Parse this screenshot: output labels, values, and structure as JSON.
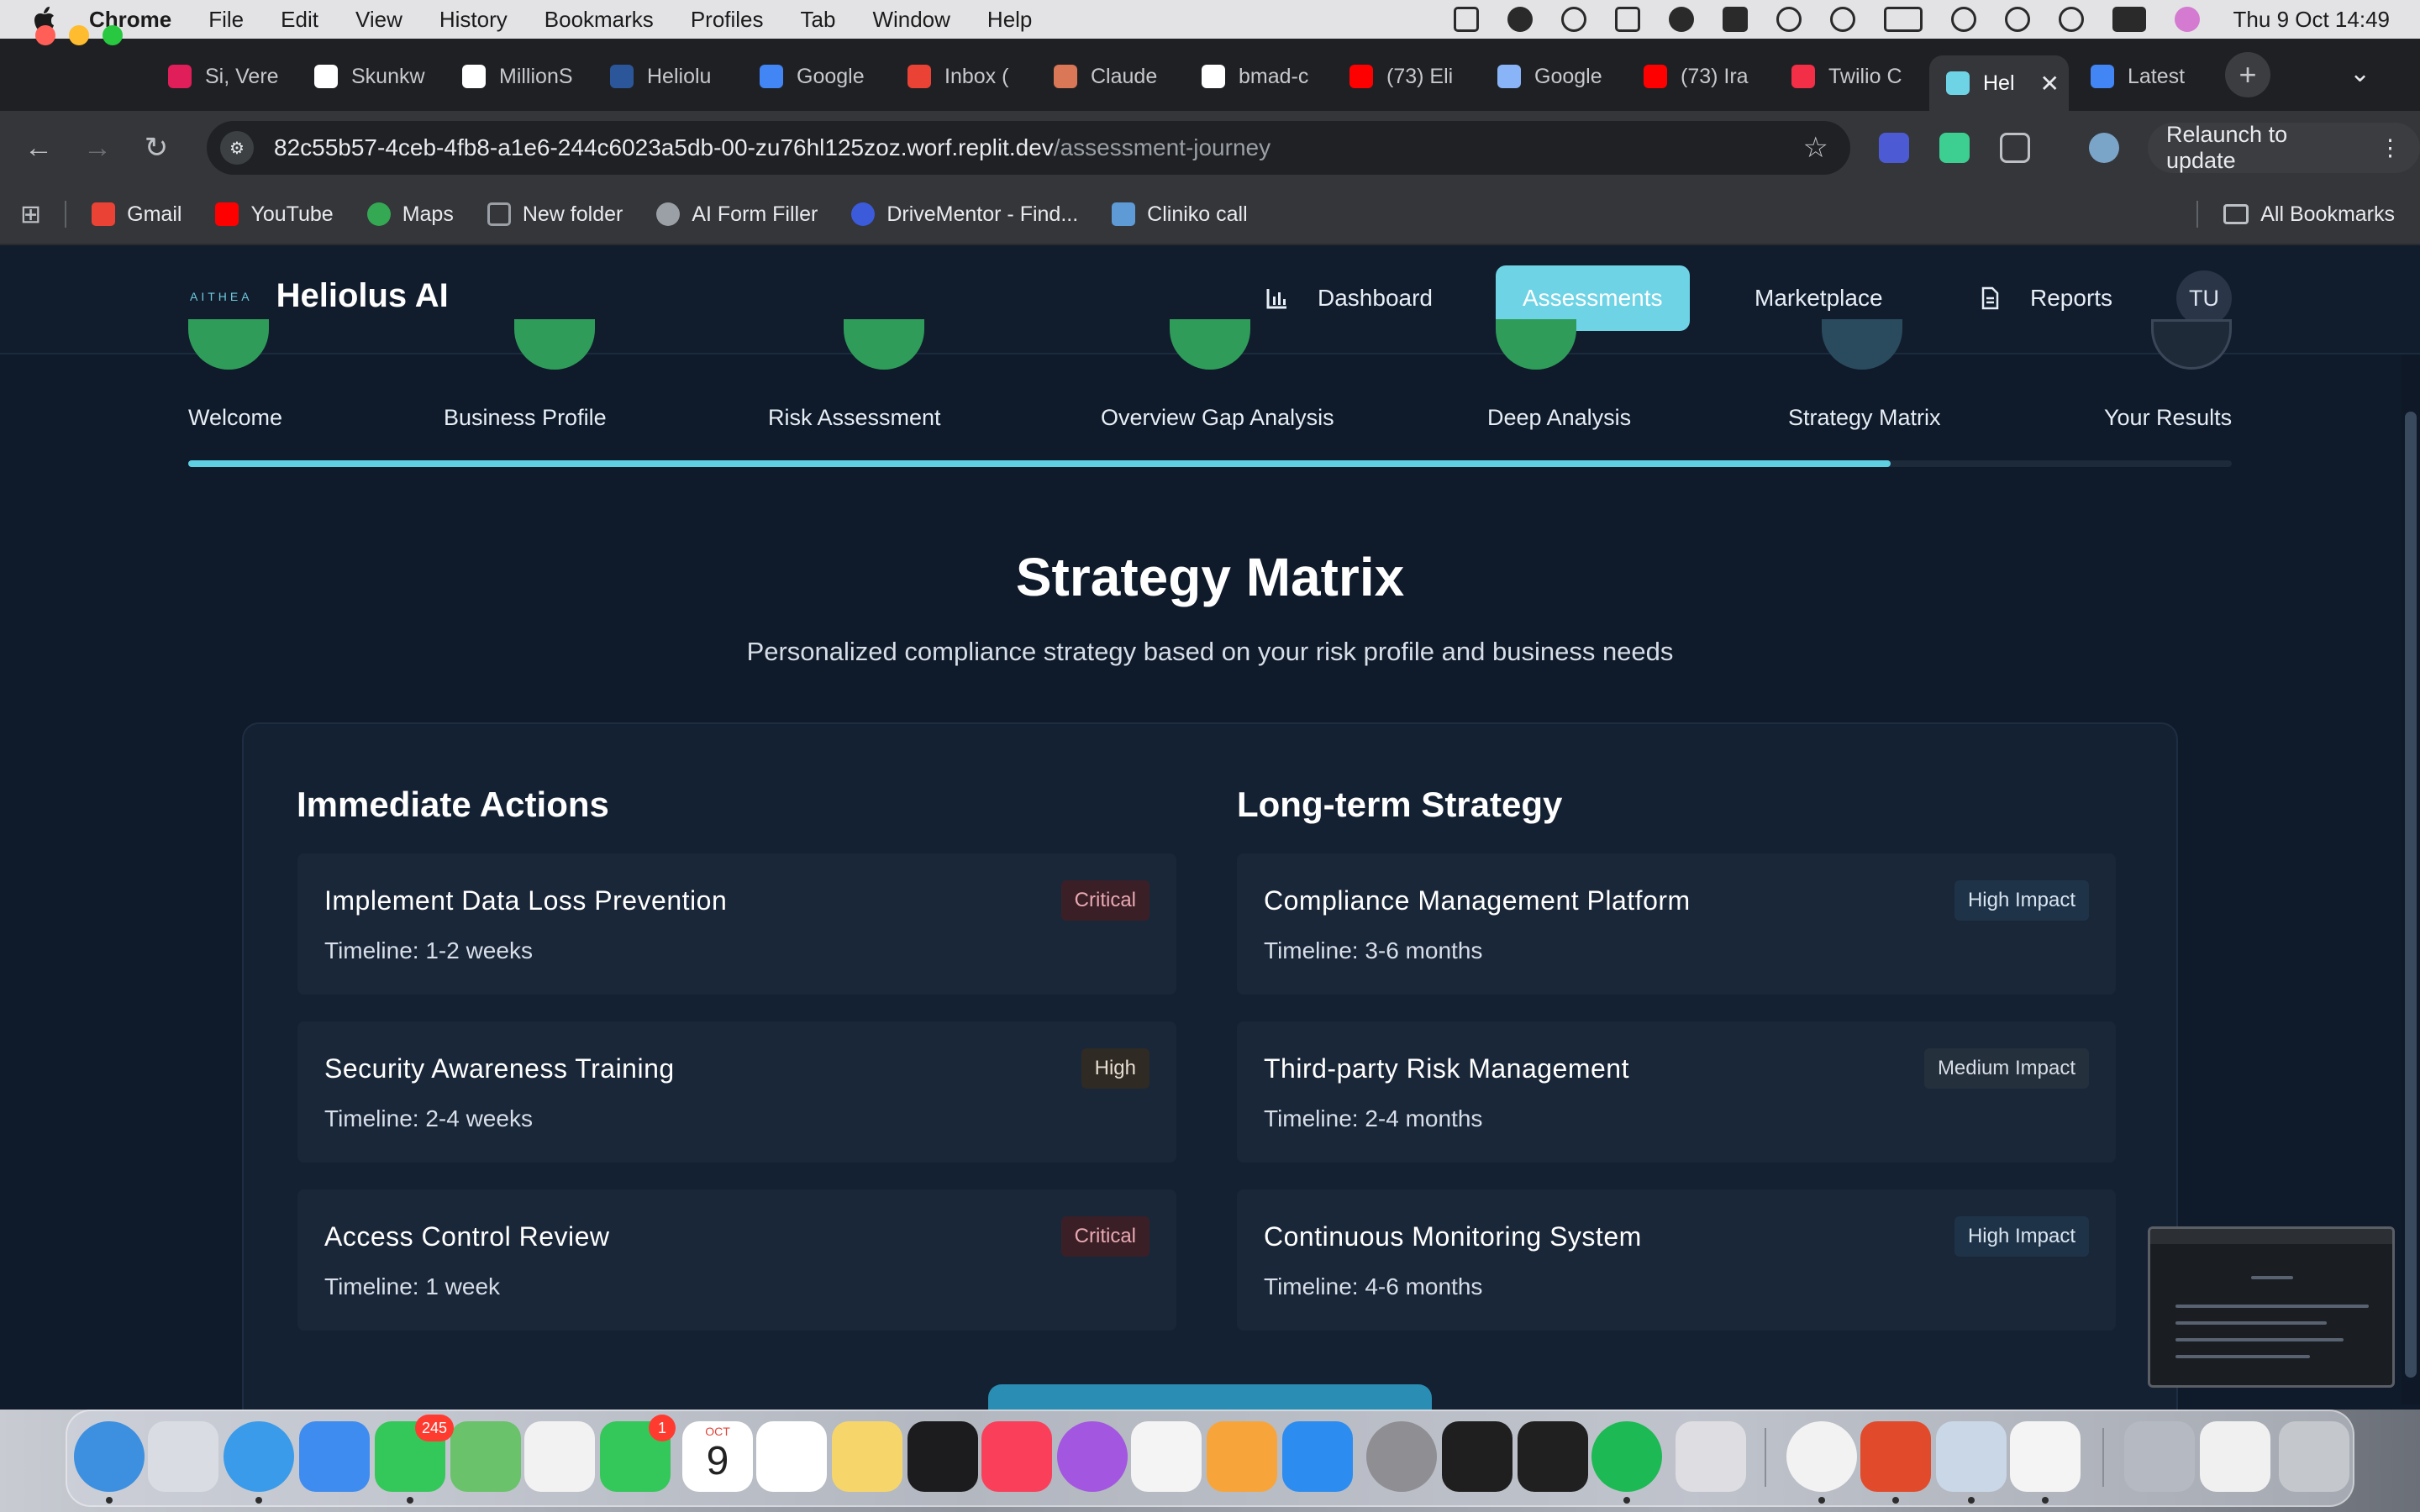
{
  "menubar": {
    "app": "Chrome",
    "items": [
      "File",
      "Edit",
      "View",
      "History",
      "Bookmarks",
      "Profiles",
      "Tab",
      "Window",
      "Help"
    ],
    "clock": "Thu 9 Oct  14:49"
  },
  "tabs": [
    {
      "label": "Si, Vere",
      "color": "#e01e5a"
    },
    {
      "label": "Skunkw",
      "color": "#ffffff"
    },
    {
      "label": "MillionS",
      "color": "#ffffff"
    },
    {
      "label": "Heliolu",
      "color": "#2b579a"
    },
    {
      "label": "Google",
      "color": "#4285f4"
    },
    {
      "label": "Inbox (",
      "color": "#ea4335"
    },
    {
      "label": "Claude",
      "color": "#d97757"
    },
    {
      "label": "bmad-c",
      "color": "#ffffff"
    },
    {
      "label": "(73) Eli",
      "color": "#ff0000"
    },
    {
      "label": "Google",
      "color": "#8ab4f8"
    },
    {
      "label": "(73) Ira",
      "color": "#ff0000"
    },
    {
      "label": "Twilio C",
      "color": "#f22f46"
    }
  ],
  "active_tab": {
    "label": "Hel",
    "close": "✕"
  },
  "after_tab": {
    "label": "Latest",
    "color": "#4285f4"
  },
  "toolbar": {
    "url_host": "82c55b57-4ceb-4fb8-a1e6-244c6023a5db-00-zu76hl125zoz.worf.replit.dev",
    "url_path": "/assessment-journey",
    "relaunch": "Relaunch to update"
  },
  "bookmarks": [
    {
      "label": "Gmail",
      "color": "#ea4335"
    },
    {
      "label": "YouTube",
      "color": "#ff0000"
    },
    {
      "label": "Maps",
      "color": "#34a853"
    },
    {
      "label": "New folder",
      "color": "#9aa0a6"
    },
    {
      "label": "AI Form Filler",
      "color": "#9aa0a6"
    },
    {
      "label": "DriveMentor - Find...",
      "color": "#3b5bdb"
    },
    {
      "label": "Cliniko call",
      "color": "#5e9ad6"
    }
  ],
  "all_bookmarks": "All Bookmarks",
  "app": {
    "logo_mark": "AITHEA",
    "name": "Heliolus AI",
    "nav": {
      "dashboard": "Dashboard",
      "assessments": "Assessments",
      "marketplace": "Marketplace",
      "reports": "Reports"
    },
    "user_initials": "TU",
    "accent": "#6fd3e6"
  },
  "steps": [
    {
      "label": "Welcome",
      "status": "complete"
    },
    {
      "label": "Business Profile",
      "status": "complete"
    },
    {
      "label": "Risk Assessment",
      "status": "complete"
    },
    {
      "label": "Overview Gap Analysis",
      "status": "complete"
    },
    {
      "label": "Deep Analysis",
      "status": "complete"
    },
    {
      "label": "Strategy Matrix",
      "status": "current"
    },
    {
      "label": "Your Results",
      "status": "pending"
    }
  ],
  "progress_fraction": 0.833,
  "main": {
    "title": "Strategy Matrix",
    "subtitle": "Personalized compliance strategy based on your risk profile and business needs",
    "immediate": {
      "heading": "Immediate Actions",
      "items": [
        {
          "title": "Implement Data Loss Prevention",
          "timeline": "Timeline: 1-2 weeks",
          "badge": "Critical"
        },
        {
          "title": "Security Awareness Training",
          "timeline": "Timeline: 2-4 weeks",
          "badge": "High"
        },
        {
          "title": "Access Control Review",
          "timeline": "Timeline: 1 week",
          "badge": "Critical"
        }
      ]
    },
    "longterm": {
      "heading": "Long-term Strategy",
      "items": [
        {
          "title": "Compliance Management Platform",
          "timeline": "Timeline: 3-6 months",
          "badge": "High Impact"
        },
        {
          "title": "Third-party Risk Management",
          "timeline": "Timeline: 2-4 months",
          "badge": "Medium Impact"
        },
        {
          "title": "Continuous Monitoring System",
          "timeline": "Timeline: 4-6 months",
          "badge": "High Impact"
        }
      ]
    }
  },
  "dock": {
    "messages_badge": "245",
    "facetime_badge": "1",
    "calendar_month": "OCT",
    "calendar_day": "9"
  }
}
